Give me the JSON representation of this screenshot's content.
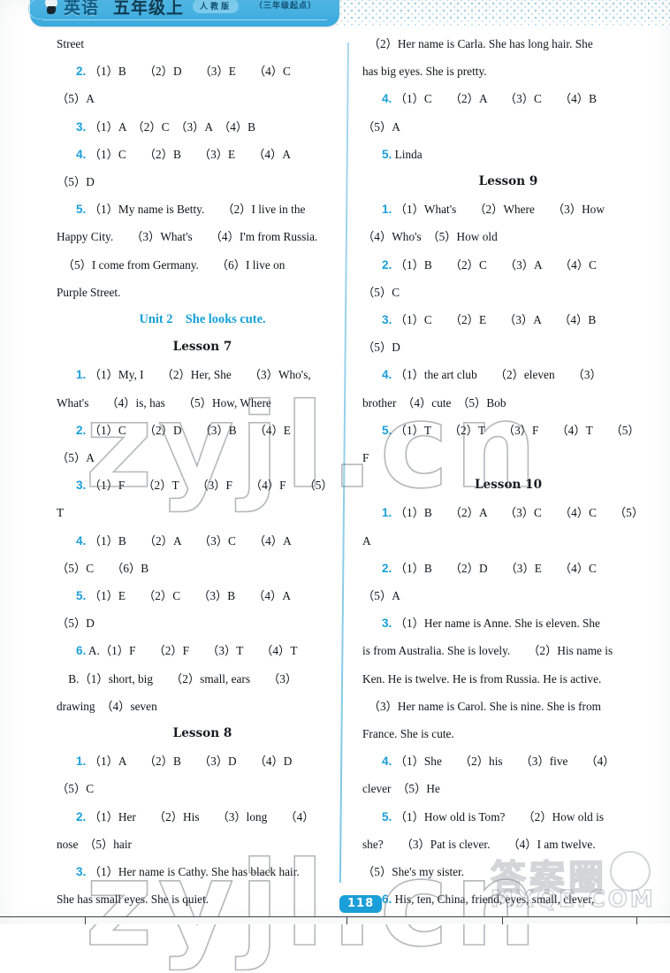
{
  "header": {
    "subject": "英语",
    "grade": "五年级上",
    "edition_pill": "人教版",
    "start_note": "（三年级起点）",
    "bulb_icon": "lightbulb-icon"
  },
  "left_column": {
    "lines": [
      {
        "type": "text",
        "content": "Street"
      },
      {
        "type": "item",
        "num": "2.",
        "content": "（1）B　　（2）D　　（3）E　　（4）C"
      },
      {
        "type": "text",
        "content": "（5）A"
      },
      {
        "type": "item",
        "num": "3.",
        "content": "（1）A　（2）C　（3）A　（4）B"
      },
      {
        "type": "item",
        "num": "4.",
        "content": "（1）C　　（2）B　　（3）E　　（4）A"
      },
      {
        "type": "text",
        "content": "（5）D"
      },
      {
        "type": "item",
        "num": "5.",
        "content": "（1）My name is Betty.　　（2）I live in the"
      },
      {
        "type": "text",
        "content": "Happy City.　　（3）What's　　（4）I'm from Russia."
      },
      {
        "type": "text",
        "content": "　（5）I come from Germany.　　（6）I live on"
      },
      {
        "type": "text",
        "content": "Purple Street."
      },
      {
        "type": "unit",
        "content": "Unit 2　She looks cute."
      },
      {
        "type": "lesson",
        "content": "Lesson 7"
      },
      {
        "type": "item",
        "num": "1.",
        "content": "（1）My, I　　（2）Her, She　　（3）Who's,"
      },
      {
        "type": "text",
        "content": "What's　　（4）is, has　　（5）How, Where"
      },
      {
        "type": "item",
        "num": "2.",
        "content": "（1）C　　（2）D　　（3）B　　（4）E"
      },
      {
        "type": "text",
        "content": "（5）A"
      },
      {
        "type": "item",
        "num": "3.",
        "content": "（1）F　　（2）T　　（3）F　　（4）F　　（5）"
      },
      {
        "type": "text",
        "content": "T"
      },
      {
        "type": "item",
        "num": "4.",
        "content": "（1）B　　（2）A　　（3）C　　（4）A"
      },
      {
        "type": "text",
        "content": "（5）C　　（6）B"
      },
      {
        "type": "item",
        "num": "5.",
        "content": "（1）E　　（2）C　　（3）B　　（4）A"
      },
      {
        "type": "text",
        "content": "（5）D"
      },
      {
        "type": "item",
        "num": "6.",
        "content": "A.（1）F　　（2）F　　（3）T　　（4）T"
      },
      {
        "type": "text",
        "content": "　B.（1）short, big　　（2）small, ears　　（3）"
      },
      {
        "type": "text",
        "content": "drawing　（4）seven"
      },
      {
        "type": "lesson",
        "content": "Lesson 8"
      },
      {
        "type": "item",
        "num": "1.",
        "content": "（1）A　　（2）B　　（3）D　　（4）D"
      },
      {
        "type": "text",
        "content": "（5）C"
      },
      {
        "type": "item",
        "num": "2.",
        "content": "（1）Her　　（2）His　　（3）long　　（4）"
      },
      {
        "type": "text",
        "content": "nose　（5）hair"
      },
      {
        "type": "item",
        "num": "3.",
        "content": "（1）Her name is Cathy. She has black hair."
      },
      {
        "type": "text",
        "content": "She has small eyes. She is quiet."
      }
    ]
  },
  "right_column": {
    "lines": [
      {
        "type": "text",
        "content": "　（2）Her name is Carla. She has long hair. She"
      },
      {
        "type": "text",
        "content": "has big eyes. She is pretty."
      },
      {
        "type": "item",
        "num": "4.",
        "content": "（1）C　　（2）A　　（3）C　　（4）B"
      },
      {
        "type": "text",
        "content": "（5）A"
      },
      {
        "type": "item",
        "num": "5.",
        "content": "Linda"
      },
      {
        "type": "lesson",
        "content": "Lesson 9"
      },
      {
        "type": "item",
        "num": "1.",
        "content": "（1）What's　　（2）Where　　（3）How"
      },
      {
        "type": "text",
        "content": "（4）Who's　（5）How old"
      },
      {
        "type": "item",
        "num": "2.",
        "content": "（1）B　　（2）C　　（3）A　　（4）C"
      },
      {
        "type": "text",
        "content": "（5）C"
      },
      {
        "type": "item",
        "num": "3.",
        "content": "（1）C　　（2）E　　（3）A　　（4）B"
      },
      {
        "type": "text",
        "content": "（5）D"
      },
      {
        "type": "item",
        "num": "4.",
        "content": "（1）the art club　　（2）eleven　　（3）"
      },
      {
        "type": "text",
        "content": "brother　（4）cute　（5）Bob"
      },
      {
        "type": "item",
        "num": "5.",
        "content": "（1）T　　（2）T　　（3）F　　（4）T　　（5）"
      },
      {
        "type": "text",
        "content": "F"
      },
      {
        "type": "lesson",
        "content": "Lesson 10"
      },
      {
        "type": "item",
        "num": "1.",
        "content": "（1）B　　（2）A　　（3）C　　（4）C　　（5）"
      },
      {
        "type": "text",
        "content": "A"
      },
      {
        "type": "item",
        "num": "2.",
        "content": "（1）B　　（2）D　　（3）E　　（4）C"
      },
      {
        "type": "text",
        "content": "（5）A"
      },
      {
        "type": "item",
        "num": "3.",
        "content": "（1）Her name is Anne. She is eleven. She"
      },
      {
        "type": "text",
        "content": "is from Australia. She is lovely.　　（2）His name is"
      },
      {
        "type": "text",
        "content": "Ken. He is twelve. He is from Russia. He is active."
      },
      {
        "type": "text",
        "content": "　（3）Her name is Carol. She is nine. She is from"
      },
      {
        "type": "text",
        "content": "France. She is cute."
      },
      {
        "type": "item",
        "num": "4.",
        "content": "（1）She　　（2）his　　（3）five　　（4）"
      },
      {
        "type": "text",
        "content": "clever　（5）He"
      },
      {
        "type": "item",
        "num": "5.",
        "content": "（1）How old is Tom?　　（2）How old is"
      },
      {
        "type": "text",
        "content": "she?　　（3）Pat is clever.　　（4）I am twelve."
      },
      {
        "type": "text",
        "content": "（5）She's my sister."
      },
      {
        "type": "item",
        "num": "6.",
        "content": "His, ten, China, friend, eyes, small, clever,"
      }
    ]
  },
  "watermarks": {
    "site": "zyjl.cn",
    "brand_cn": "答案圈",
    "brand_domain": "MXQE.COM"
  },
  "footer": {
    "page_number": "118"
  },
  "colors": {
    "accent_blue": "#1b9fd8",
    "header_band": "#49b4e4",
    "text": "#111418"
  }
}
